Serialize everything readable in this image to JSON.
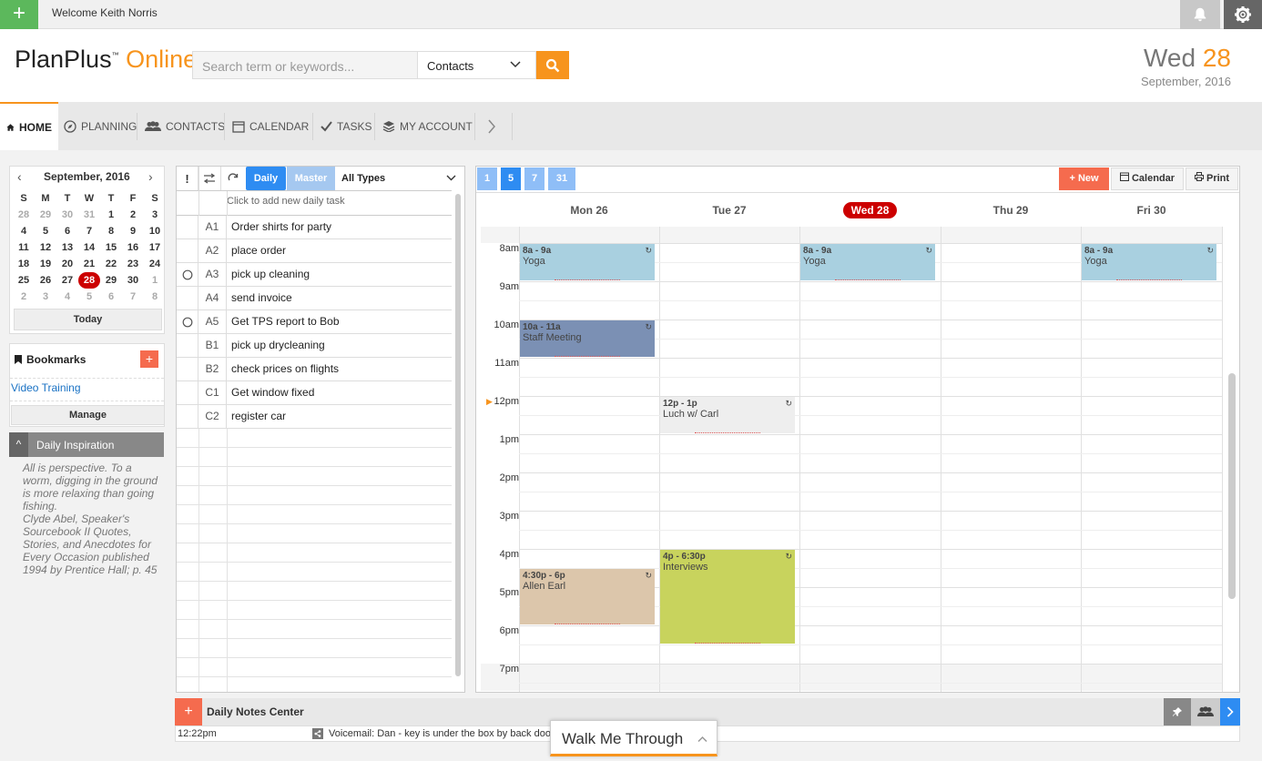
{
  "topbar": {
    "add": "+",
    "welcome": "Welcome Keith Norris"
  },
  "header": {
    "logo_main": "PlanPlus",
    "logo_tm": "™",
    "logo_accent": "Online",
    "search_placeholder": "Search term or keywords...",
    "search_type": "Contacts",
    "date_weekday": "Wed",
    "date_number": "28",
    "date_full": "September, 2016"
  },
  "nav": {
    "home": "HOME",
    "planning": "PLANNING",
    "contacts": "CONTACTS",
    "calendar": "CALENDAR",
    "tasks": "TASKS",
    "account": "MY ACCOUNT"
  },
  "minical": {
    "title": "September, 2016",
    "prev": "‹",
    "next": "›",
    "weekdays": [
      "S",
      "M",
      "T",
      "W",
      "T",
      "F",
      "S"
    ],
    "days": [
      "28",
      "29",
      "30",
      "31",
      "1",
      "2",
      "3",
      "4",
      "5",
      "6",
      "7",
      "8",
      "9",
      "10",
      "11",
      "12",
      "13",
      "14",
      "15",
      "16",
      "17",
      "18",
      "19",
      "20",
      "21",
      "22",
      "23",
      "24",
      "25",
      "26",
      "27",
      "28",
      "29",
      "30",
      "1",
      "2",
      "3",
      "4",
      "5",
      "6",
      "7",
      "8"
    ],
    "today_label": "Today"
  },
  "bookmarks": {
    "title": "Bookmarks",
    "add": "+",
    "link": "Video Training",
    "manage": "Manage"
  },
  "inspiration": {
    "title": "Daily Inspiration",
    "toggle": "^",
    "text": "All is perspective. To a worm, digging in the ground is more relaxing than going fishing.",
    "source": "Clyde Abel, Speaker's Sourcebook II Quotes, Stories, and Anecdotes for Every Occasion published 1994 by Prentice Hall; p. 45"
  },
  "tasks": {
    "priority": "!",
    "daily": "Daily",
    "master": "Master",
    "filter": "All Types",
    "add_placeholder": "Click to add new daily task",
    "items": [
      {
        "code": "A1",
        "text": "Order shirts for party",
        "circle": false
      },
      {
        "code": "A2",
        "text": "place order",
        "circle": false
      },
      {
        "code": "A3",
        "text": "pick up cleaning",
        "circle": true
      },
      {
        "code": "A4",
        "text": "send invoice",
        "circle": false
      },
      {
        "code": "A5",
        "text": "Get TPS report to Bob",
        "circle": true
      },
      {
        "code": "B1",
        "text": "pick up drycleaning",
        "circle": false
      },
      {
        "code": "B2",
        "text": "check prices on flights",
        "circle": false
      },
      {
        "code": "C1",
        "text": "Get window fixed",
        "circle": false
      },
      {
        "code": "C2",
        "text": "register car",
        "circle": false
      }
    ]
  },
  "calendar": {
    "views": [
      "1",
      "5",
      "7",
      "31"
    ],
    "new_label": "New",
    "calendar_label": "Calendar",
    "print_label": "Print",
    "days": [
      "Mon 26",
      "Tue 27",
      "Wed 28",
      "Thu 29",
      "Fri 30"
    ],
    "today_index": 2,
    "hours": [
      "8am",
      "9am",
      "10am",
      "11am",
      "12pm",
      "1pm",
      "2pm",
      "3pm",
      "4pm",
      "5pm",
      "6pm",
      "7pm"
    ],
    "now_marker": "▶",
    "events": [
      {
        "day": 0,
        "time": "8a - 9a",
        "title": "Yoga",
        "color": "#a9d0e0"
      },
      {
        "day": 2,
        "time": "8a - 9a",
        "title": "Yoga",
        "color": "#a9d0e0"
      },
      {
        "day": 4,
        "time": "8a - 9a",
        "title": "Yoga",
        "color": "#a9d0e0"
      },
      {
        "day": 0,
        "time": "10a - 11a",
        "title": "Staff Meeting",
        "color": "#7b90b4"
      },
      {
        "day": 1,
        "time": "12p - 1p",
        "title": "Luch w/ Carl",
        "color": "#eeeeee"
      },
      {
        "day": 1,
        "time": "4p - 6:30p",
        "title": "Interviews",
        "color": "#c8d35d"
      },
      {
        "day": 0,
        "time": "4:30p - 6p",
        "title": "Allen Earl",
        "color": "#dcc6ab"
      }
    ]
  },
  "notes": {
    "add": "+",
    "title": "Daily Notes Center",
    "time": "12:22pm",
    "text": "Voicemail: Dan - key is under the box by back door"
  },
  "walkme": {
    "label": "Walk Me Through"
  }
}
